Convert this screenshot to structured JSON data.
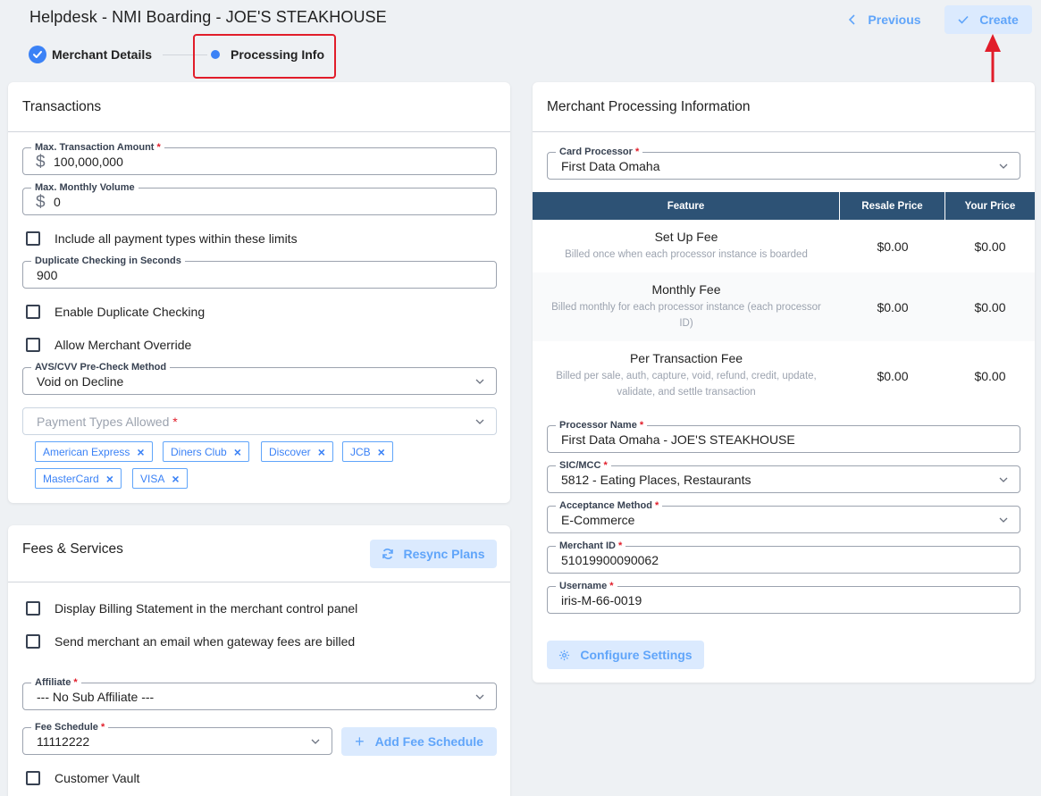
{
  "header": {
    "title": "Helpdesk - NMI Boarding - JOE'S STEAKHOUSE",
    "previous_label": "Previous",
    "create_label": "Create"
  },
  "steps": [
    {
      "label": "Merchant Details",
      "state": "complete"
    },
    {
      "label": "Processing Info",
      "state": "active"
    }
  ],
  "transactions": {
    "title": "Transactions",
    "max_amount": {
      "label": "Max. Transaction Amount",
      "value": "100,000,000",
      "prefix": "$"
    },
    "max_monthly": {
      "label": "Max. Monthly Volume",
      "value": "0",
      "prefix": "$"
    },
    "include_all_label": "Include all payment types within these limits",
    "duplicate_seconds": {
      "label": "Duplicate Checking in Seconds",
      "value": "900"
    },
    "enable_duplicate_label": "Enable Duplicate Checking",
    "allow_override_label": "Allow Merchant Override",
    "avs_method": {
      "label": "AVS/CVV Pre-Check Method",
      "value": "Void on Decline"
    },
    "payment_types": {
      "placeholder": "Payment Types Allowed"
    },
    "payment_tags": [
      "American Express",
      "Diners Club",
      "Discover",
      "JCB",
      "MasterCard",
      "VISA"
    ]
  },
  "fees": {
    "title": "Fees & Services",
    "resync_label": "Resync Plans",
    "display_billing_label": "Display Billing Statement in the merchant control panel",
    "send_email_label": "Send merchant an email when gateway fees are billed",
    "affiliate": {
      "label": "Affiliate",
      "value": "--- No Sub Affiliate ---"
    },
    "fee_schedule": {
      "label": "Fee Schedule",
      "value": "11112222"
    },
    "add_fee_label": "Add Fee Schedule",
    "customer_vault_label": "Customer Vault"
  },
  "processing": {
    "title": "Merchant Processing Information",
    "card_processor": {
      "label": "Card Processor",
      "value": "First Data Omaha"
    },
    "table": {
      "headers": [
        "Feature",
        "Resale Price",
        "Your Price"
      ],
      "rows": [
        {
          "name": "Set Up Fee",
          "desc": "Billed once when each processor instance is boarded",
          "resale": "$0.00",
          "your": "$0.00"
        },
        {
          "name": "Monthly Fee",
          "desc": "Billed monthly for each processor instance (each processor ID)",
          "resale": "$0.00",
          "your": "$0.00"
        },
        {
          "name": "Per Transaction Fee",
          "desc": "Billed per sale, auth, capture, void, refund, credit, update, validate, and settle transaction",
          "resale": "$0.00",
          "your": "$0.00"
        }
      ]
    },
    "processor_name": {
      "label": "Processor Name",
      "value": "First Data Omaha - JOE'S STEAKHOUSE"
    },
    "sic_mcc": {
      "label": "SIC/MCC",
      "value": "5812 - Eating Places, Restaurants"
    },
    "acceptance": {
      "label": "Acceptance Method",
      "value": "E-Commerce"
    },
    "merchant_id": {
      "label": "Merchant ID",
      "value": "51019900090062"
    },
    "username": {
      "label": "Username",
      "value": "iris-M-66-0019"
    },
    "configure_label": "Configure Settings"
  },
  "colors": {
    "accent": "#3b82f6",
    "soft_button_bg": "#dbeafe",
    "table_header": "#2d5275",
    "highlight": "#e11d2a"
  }
}
